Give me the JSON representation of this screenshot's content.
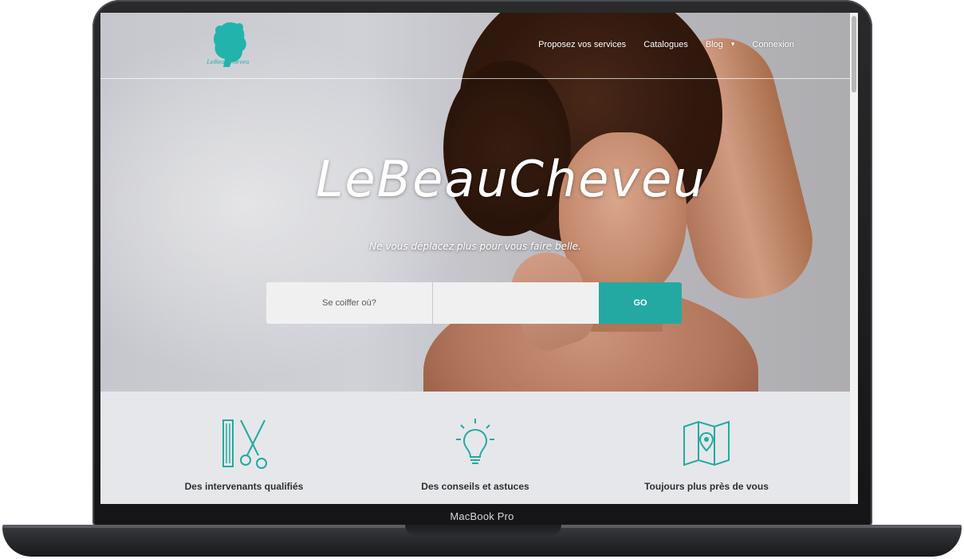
{
  "device": {
    "label": "MacBook Pro"
  },
  "site": {
    "logo_text": "LeBeauCheveu",
    "nav": [
      "Proposez vos services",
      "Catalogues",
      "Blog",
      "Connexion"
    ],
    "nav_arrow": "▾",
    "hero_title": "LeBeauCheveu",
    "tagline": "Ne vous déplacez plus pour vous faire belle.",
    "search": {
      "where_placeholder": "Se coiffer où?",
      "what_value": "",
      "go_label": "GO"
    },
    "features": [
      {
        "icon": "scissors-comb-icon",
        "label": "Des intervenants qualifiés"
      },
      {
        "icon": "lightbulb-icon",
        "label": "Des conseils et astuces"
      },
      {
        "icon": "map-pin-icon",
        "label": "Toujours plus près de vous"
      }
    ]
  },
  "colors": {
    "accent": "#24a9a2",
    "logo": "#22b3ac"
  }
}
